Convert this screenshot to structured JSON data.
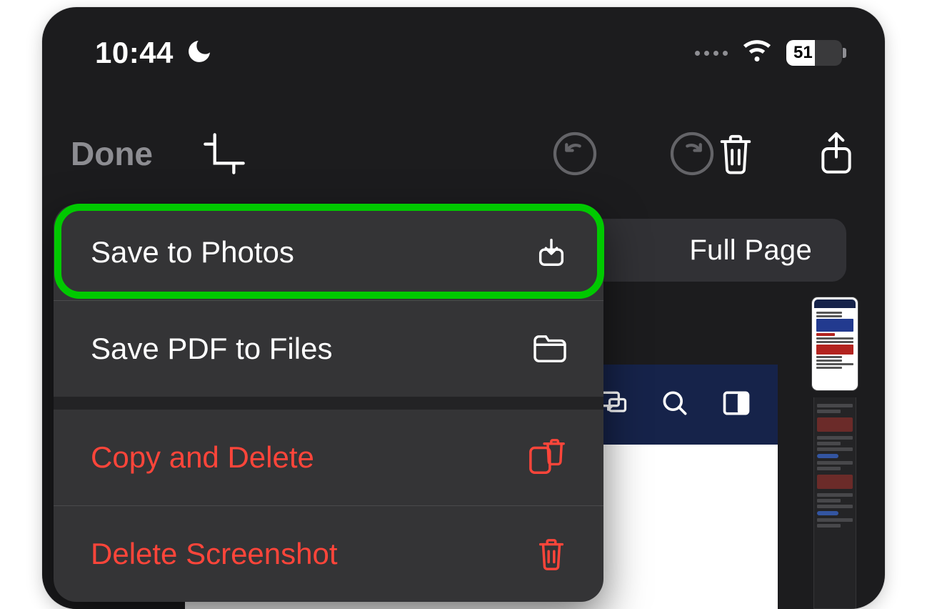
{
  "status_bar": {
    "time": "10:44",
    "battery_level": "51"
  },
  "toolbar": {
    "done_label": "Done"
  },
  "segmented": {
    "full_page_label": "Full Page"
  },
  "menu": {
    "items": [
      {
        "label": "Save to Photos",
        "destructive": false
      },
      {
        "label": "Save PDF to Files",
        "destructive": false
      },
      {
        "label": "Copy and Delete",
        "destructive": true
      },
      {
        "label": "Delete Screenshot",
        "destructive": true
      }
    ]
  }
}
